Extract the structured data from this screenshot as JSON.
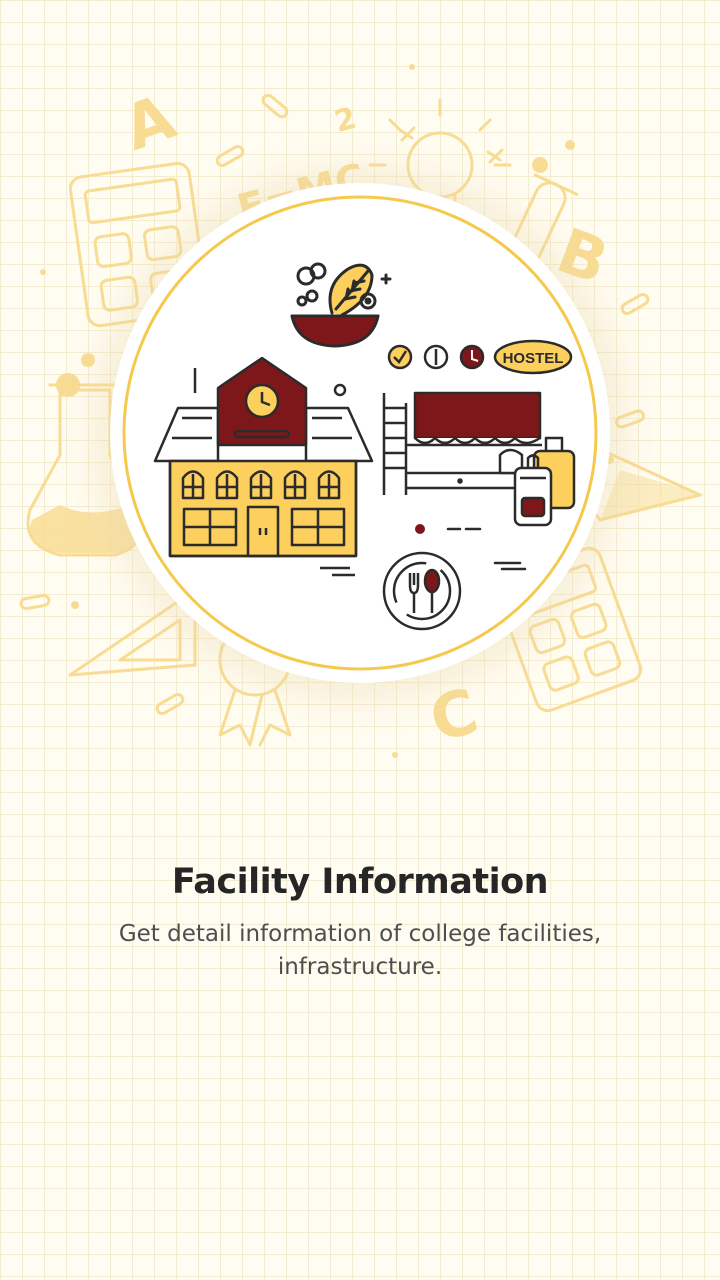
{
  "slide": {
    "title": "Facility Information",
    "description": "Get detail information of college facilities, infrastructure."
  },
  "illustration": {
    "hostel_sign": "HOSTEL",
    "formula": "E=MC",
    "formula_exponent": "2",
    "letters": [
      "A",
      "B",
      "C"
    ]
  },
  "colors": {
    "maroon": "#7d1719",
    "yellow": "#fdcf5c",
    "ring": "#f5c94b",
    "outline": "#2b2b2b",
    "doodle": "#f8dc93"
  }
}
